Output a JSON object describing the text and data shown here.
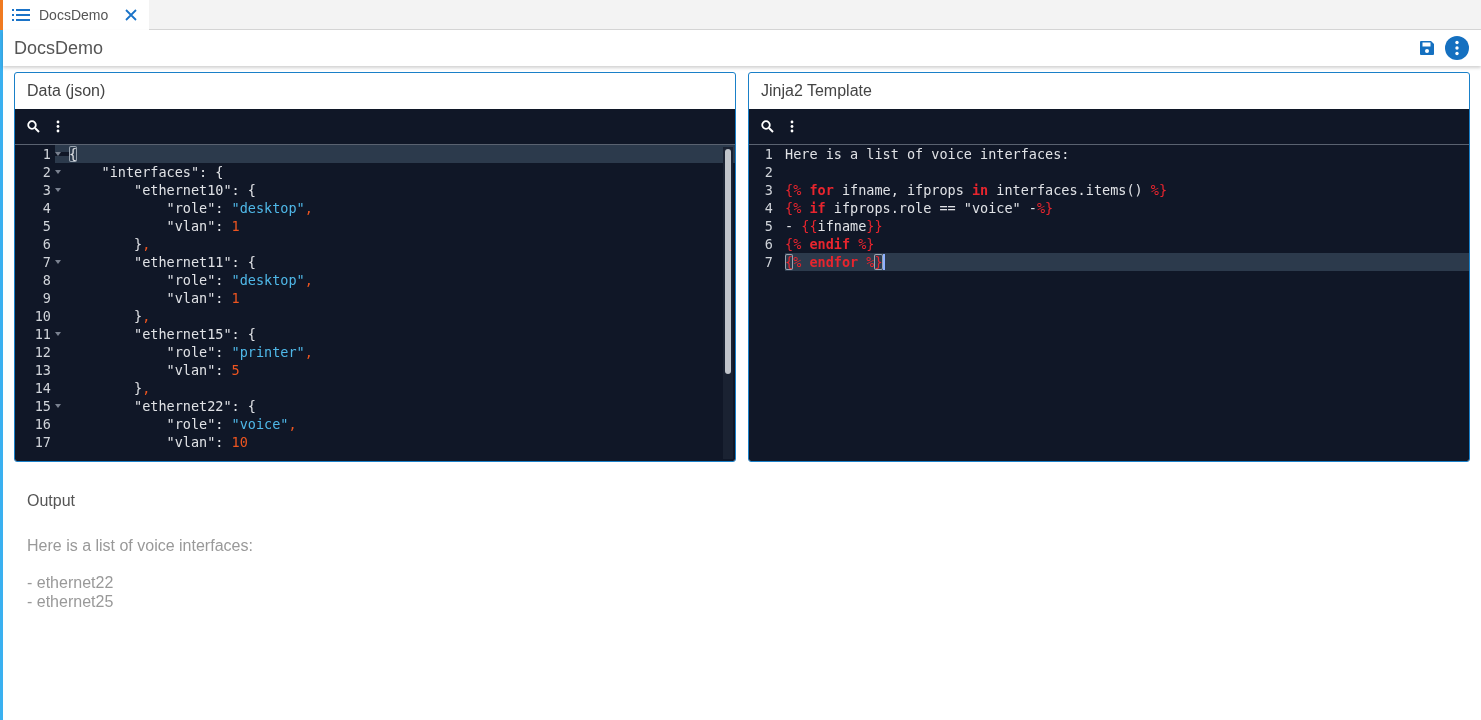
{
  "tabs": [
    {
      "label": "DocsDemo",
      "selected": true
    }
  ],
  "header": {
    "title": "DocsDemo"
  },
  "panels": [
    {
      "title": "Data (json)",
      "scrollbar": true,
      "lines": [
        {
          "number": "1",
          "foldable": true,
          "active": true,
          "tokens": [
            {
              "kind": "match",
              "text": "{"
            }
          ]
        },
        {
          "number": "2",
          "foldable": true,
          "active": false,
          "tokens": [
            {
              "kind": "plain",
              "text": "    \"interfaces\": {"
            }
          ]
        },
        {
          "number": "3",
          "foldable": true,
          "active": false,
          "tokens": [
            {
              "kind": "plain",
              "text": "        \"ethernet10\": {"
            }
          ]
        },
        {
          "number": "4",
          "foldable": false,
          "active": false,
          "tokens": [
            {
              "kind": "plain",
              "text": "            \"role\": "
            },
            {
              "kind": "string",
              "text": "\"desktop\""
            },
            {
              "kind": "number",
              "text": ","
            }
          ]
        },
        {
          "number": "5",
          "foldable": false,
          "active": false,
          "tokens": [
            {
              "kind": "plain",
              "text": "            \"vlan\": "
            },
            {
              "kind": "number",
              "text": "1"
            }
          ]
        },
        {
          "number": "6",
          "foldable": false,
          "active": false,
          "tokens": [
            {
              "kind": "plain",
              "text": "        }"
            },
            {
              "kind": "number",
              "text": ","
            }
          ]
        },
        {
          "number": "7",
          "foldable": true,
          "active": false,
          "tokens": [
            {
              "kind": "plain",
              "text": "        \"ethernet11\": {"
            }
          ]
        },
        {
          "number": "8",
          "foldable": false,
          "active": false,
          "tokens": [
            {
              "kind": "plain",
              "text": "            \"role\": "
            },
            {
              "kind": "string",
              "text": "\"desktop\""
            },
            {
              "kind": "number",
              "text": ","
            }
          ]
        },
        {
          "number": "9",
          "foldable": false,
          "active": false,
          "tokens": [
            {
              "kind": "plain",
              "text": "            \"vlan\": "
            },
            {
              "kind": "number",
              "text": "1"
            }
          ]
        },
        {
          "number": "10",
          "foldable": false,
          "active": false,
          "tokens": [
            {
              "kind": "plain",
              "text": "        }"
            },
            {
              "kind": "number",
              "text": ","
            }
          ]
        },
        {
          "number": "11",
          "foldable": true,
          "active": false,
          "tokens": [
            {
              "kind": "plain",
              "text": "        \"ethernet15\": {"
            }
          ]
        },
        {
          "number": "12",
          "foldable": false,
          "active": false,
          "tokens": [
            {
              "kind": "plain",
              "text": "            \"role\": "
            },
            {
              "kind": "string",
              "text": "\"printer\""
            },
            {
              "kind": "number",
              "text": ","
            }
          ]
        },
        {
          "number": "13",
          "foldable": false,
          "active": false,
          "tokens": [
            {
              "kind": "plain",
              "text": "            \"vlan\": "
            },
            {
              "kind": "number",
              "text": "5"
            }
          ]
        },
        {
          "number": "14",
          "foldable": false,
          "active": false,
          "tokens": [
            {
              "kind": "plain",
              "text": "        }"
            },
            {
              "kind": "number",
              "text": ","
            }
          ]
        },
        {
          "number": "15",
          "foldable": true,
          "active": false,
          "tokens": [
            {
              "kind": "plain",
              "text": "        \"ethernet22\": {"
            }
          ]
        },
        {
          "number": "16",
          "foldable": false,
          "active": false,
          "tokens": [
            {
              "kind": "plain",
              "text": "            \"role\": "
            },
            {
              "kind": "string",
              "text": "\"voice\""
            },
            {
              "kind": "number",
              "text": ","
            }
          ]
        },
        {
          "number": "17",
          "foldable": false,
          "active": false,
          "tokens": [
            {
              "kind": "plain",
              "text": "            \"vlan\": "
            },
            {
              "kind": "number",
              "text": "10"
            }
          ]
        }
      ]
    },
    {
      "title": "Jinja2 Template",
      "scrollbar": false,
      "lines": [
        {
          "number": "1",
          "active": false,
          "tokens": [
            {
              "kind": "plain",
              "text": "Here is a list of voice interfaces:"
            }
          ]
        },
        {
          "number": "2",
          "active": false
        },
        {
          "number": "3",
          "active": false,
          "tokens": [
            {
              "kind": "tag",
              "text": "{%"
            },
            {
              "kind": "keyword",
              "text": " for"
            },
            {
              "kind": "plain",
              "text": " ifname, ifprops "
            },
            {
              "kind": "keyword",
              "text": "in"
            },
            {
              "kind": "plain",
              "text": " interfaces.items() "
            },
            {
              "kind": "tag",
              "text": "%}"
            }
          ]
        },
        {
          "number": "4",
          "active": false,
          "tokens": [
            {
              "kind": "tag",
              "text": "{%"
            },
            {
              "kind": "keyword",
              "text": " if"
            },
            {
              "kind": "plain",
              "text": " ifprops.role == \"voice\" -"
            },
            {
              "kind": "tag",
              "text": "%}"
            }
          ]
        },
        {
          "number": "5",
          "active": false,
          "tokens": [
            {
              "kind": "plain",
              "text": "- "
            },
            {
              "kind": "tag",
              "text": "{{"
            },
            {
              "kind": "plain",
              "text": "ifname"
            },
            {
              "kind": "tag",
              "text": "}}"
            }
          ]
        },
        {
          "number": "6",
          "active": false,
          "tokens": [
            {
              "kind": "tag",
              "text": "{%"
            },
            {
              "kind": "keyword",
              "text": " endif "
            },
            {
              "kind": "tag",
              "text": "%}"
            }
          ]
        },
        {
          "number": "7",
          "active": true,
          "cursor": true,
          "tokens": [
            {
              "kind": "match-tag",
              "text": "{"
            },
            {
              "kind": "tag",
              "text": "%"
            },
            {
              "kind": "keyword",
              "text": " endfor "
            },
            {
              "kind": "tag",
              "text": "%"
            },
            {
              "kind": "match-tag",
              "text": "}"
            }
          ]
        }
      ]
    }
  ],
  "output": {
    "title": "Output",
    "blocks": [
      {
        "lines": [
          "Here is a list of voice interfaces:"
        ]
      },
      {
        "lines": [
          "- ethernet22",
          "- ethernet25"
        ]
      }
    ]
  }
}
